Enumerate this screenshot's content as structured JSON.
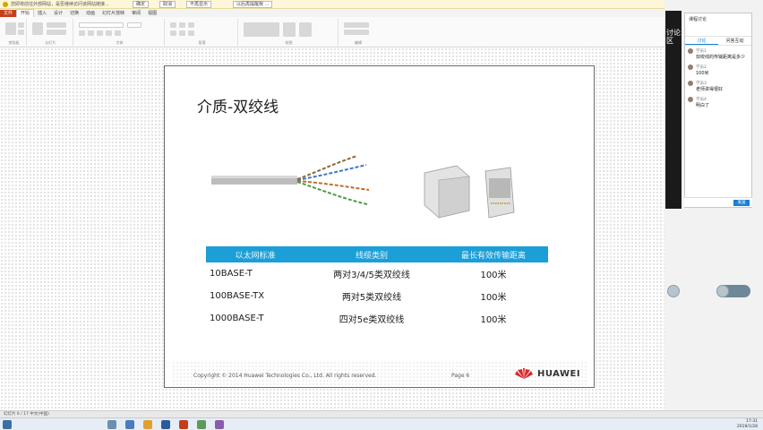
{
  "notice": {
    "text": "您即将前往外部网站，是否继续访问该网站链接...",
    "btn1": "确定",
    "btn2": "取消",
    "btn3": "不再显示",
    "btn4": "以后再提醒我 ..."
  },
  "ribbon": {
    "tabs": [
      "文件",
      "开始",
      "插入",
      "设计",
      "切换",
      "动画",
      "幻灯片放映",
      "审阅",
      "视图"
    ],
    "active_tab": "开始",
    "groups": [
      "剪贴板",
      "幻灯片",
      "字体",
      "段落",
      "绘图",
      "编辑"
    ]
  },
  "slide": {
    "title": "介质-双绞线",
    "table": {
      "headers": [
        "以太网标准",
        "线缆类别",
        "最长有效传输距离"
      ],
      "rows": [
        [
          "10BASE-T",
          "两对3/4/5类双绞线",
          "100米"
        ],
        [
          "100BASE-TX",
          "两对5类双绞线",
          "100米"
        ],
        [
          "1000BASE-T",
          "四对5e类双绞线",
          "100米"
        ]
      ]
    },
    "copyright": "Copyright © 2014 Huawei Technologies Co., Ltd. All rights reserved.",
    "page": "Page 6",
    "logo_text": "HUAWEI"
  },
  "chat": {
    "side_title": "讨论区",
    "title": "课程讨论",
    "tabs": [
      "讨论",
      "问答互动"
    ],
    "messages": [
      {
        "name": "学员1",
        "text": "双绞线的传输距离是多少"
      },
      {
        "name": "学员2",
        "text": "100米"
      },
      {
        "name": "学员3",
        "text": "老师讲得很好"
      },
      {
        "name": "学员4",
        "text": "明白了"
      }
    ],
    "send": "发送"
  },
  "status": {
    "text": "幻灯片 6 / 17    中文(中国)"
  },
  "clock": {
    "time": "17:31",
    "date": "2019/1/28"
  },
  "colors": {
    "table_header": "#1b9fd6",
    "ppt_file_tab": "#c43e1c",
    "accent": "#1b7fd6"
  }
}
